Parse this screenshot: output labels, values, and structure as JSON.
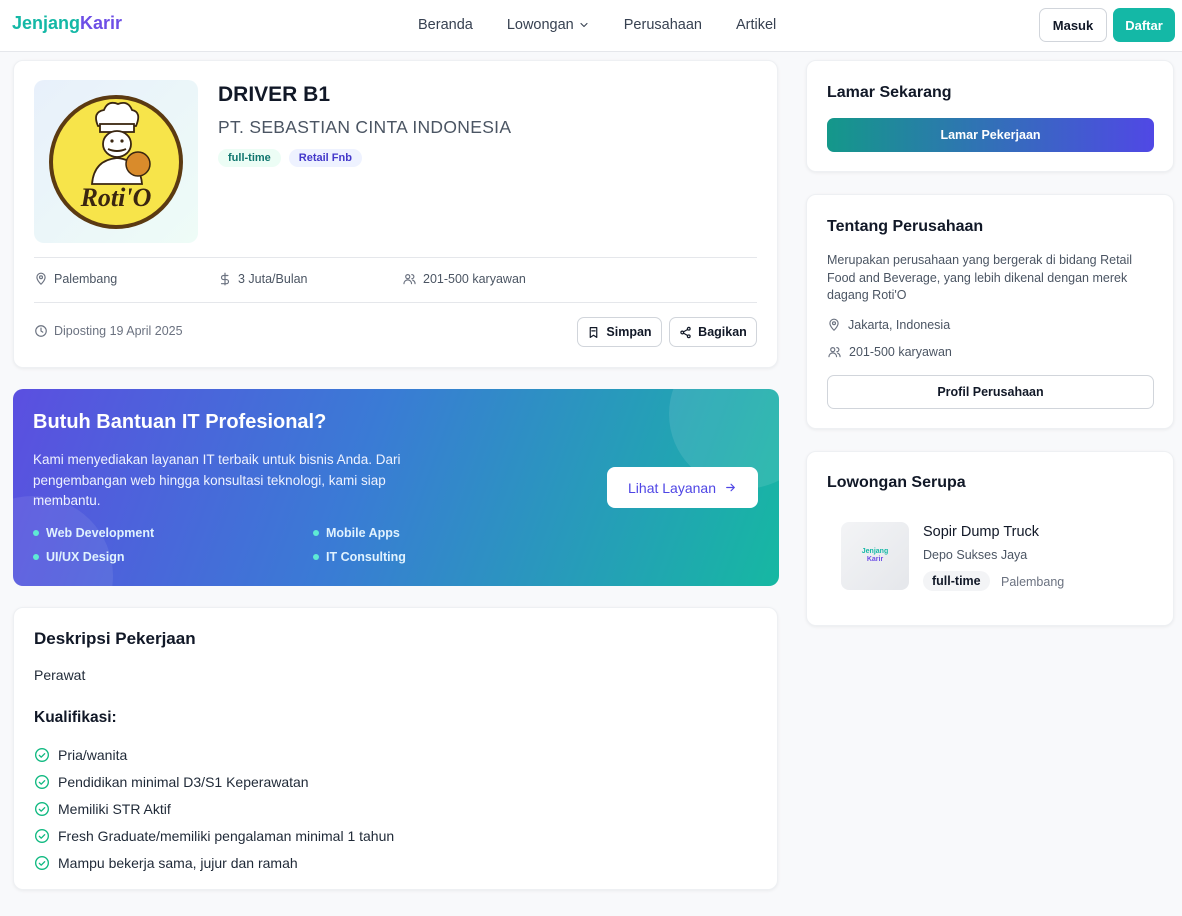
{
  "nav": {
    "logo_part1": "Jenjang",
    "logo_part2": "Karir",
    "links": [
      "Beranda",
      "Lowongan",
      "Perusahaan",
      "Artikel"
    ],
    "login_label": "Masuk",
    "register_label": "Daftar"
  },
  "job": {
    "title": "DRIVER B1",
    "company": "PT. SEBASTIAN CINTA INDONESIA",
    "logo_text": "Roti'O",
    "tags": [
      "full-time",
      "Retail Fnb"
    ],
    "location": "Palembang",
    "salary": "3 Juta/Bulan",
    "employees": "201-500 karyawan",
    "posted": "Diposting 19 April 2025",
    "save_label": "Simpan",
    "share_label": "Bagikan"
  },
  "banner": {
    "title": "Butuh Bantuan IT Profesional?",
    "description": "Kami menyediakan layanan IT terbaik untuk bisnis Anda. Dari pengembangan web hingga konsultasi teknologi, kami siap membantu.",
    "services": [
      "Web Development",
      "Mobile Apps",
      "UI/UX Design",
      "IT Consulting"
    ],
    "cta_label": "Lihat Layanan"
  },
  "description": {
    "heading": "Deskripsi Pekerjaan",
    "text": "Perawat",
    "qualification_heading": "Kualifikasi:",
    "qualifications": [
      "Pria/wanita",
      "Pendidikan minimal D3/S1 Keperawatan",
      "Memiliki STR Aktif",
      "Fresh Graduate/memiliki pengalaman minimal 1 tahun",
      "Mampu bekerja sama, jujur dan ramah"
    ]
  },
  "apply": {
    "heading": "Lamar Sekarang",
    "button_label": "Lamar Pekerjaan"
  },
  "about": {
    "heading": "Tentang Perusahaan",
    "text": "Merupakan perusahaan yang bergerak di bidang Retail Food and Beverage, yang lebih dikenal dengan merek dagang Roti'O",
    "location": "Jakarta, Indonesia",
    "employees": "201-500 karyawan",
    "profile_button": "Profil Perusahaan"
  },
  "similar": {
    "heading": "Lowongan Serupa",
    "items": [
      {
        "thumb_line1": "Jenjang",
        "thumb_line2": "Karir",
        "title": "Sopir Dump Truck",
        "company": "Depo Sukses Jaya",
        "type": "full-time",
        "location": "Palembang"
      }
    ]
  },
  "colors": {
    "brand_teal": "#14b8a6",
    "brand_purple": "#6d4ee6"
  }
}
